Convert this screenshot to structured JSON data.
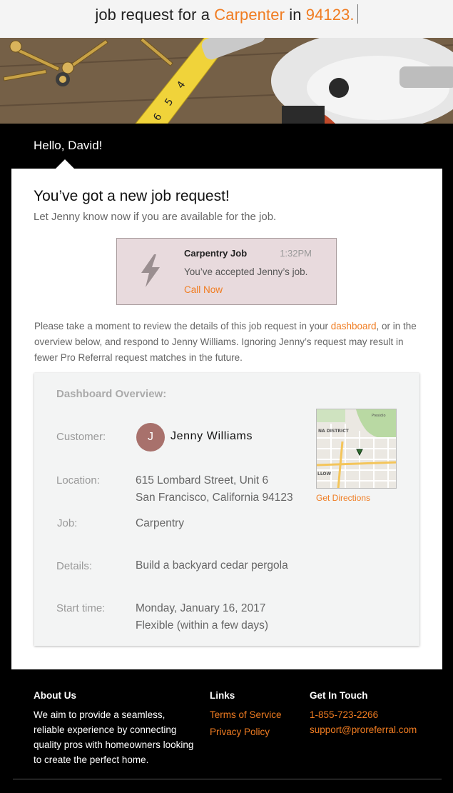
{
  "header": {
    "headline_prefix": "job request for a ",
    "trade": "Carpenter",
    "headline_mid": " in ",
    "zip": "94123."
  },
  "greeting": "Hello, David!",
  "main": {
    "title": "You’ve got a new job request!",
    "subtitle": "Let Jenny know now if you are available for the job."
  },
  "notice": {
    "icon": "lightning-bolt-icon",
    "job_title": "Carpentry Job",
    "time": "1:32PM",
    "message": "You’ve accepted Jenny’s job.",
    "call_label": "Call Now"
  },
  "paragraph": {
    "before_link": "Please take a moment to review the details of this job request in your ",
    "link": "dashboard",
    "after_link": ", or in the overview below, and respond to Jenny Williams. Ignoring Jenny’s request may result in fewer Pro Referral request matches in the future."
  },
  "overview": {
    "title": "Dashboard Overview:",
    "customer_label": "Customer:",
    "customer_initial": "J",
    "customer_name": "Jenny Williams",
    "location_label": "Location:",
    "location_line1": "615 Lombard Street, Unit 6",
    "location_line2": "San Francisco, California 94123",
    "job_label": "Job:",
    "job_value": "Carpentry",
    "details_label": "Details:",
    "details_value": "Build a backyard cedar pergola",
    "start_label": "Start time:",
    "start_line1": "Monday, January 16, 2017",
    "start_line2": "Flexible (within a few days)",
    "map_labels": [
      "Presidio",
      "NA DISTRICT",
      "LLOW"
    ],
    "directions_label": "Get Directions"
  },
  "footer": {
    "about_heading": "About Us",
    "about_text": "We aim to provide a seamless, reliable experience by connecting quality pros with homeowners looking to create the perfect home.",
    "links_heading": "Links",
    "links": [
      "Terms of Service",
      "Privacy Policy"
    ],
    "contact_heading": "Get In Touch",
    "phone": "1-855-723-2266",
    "email": "support@proreferral.com"
  },
  "colors": {
    "accent": "#f07c21",
    "page_background": "#000000",
    "notice_background": "#e8dadd",
    "avatar": "#a8716c"
  }
}
